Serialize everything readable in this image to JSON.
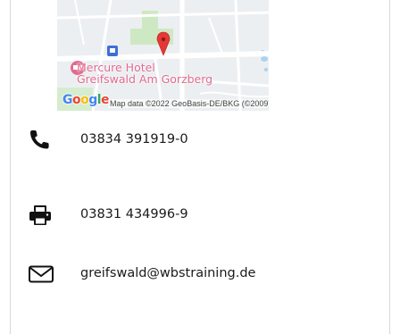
{
  "map": {
    "poi_name_line1": "Mercure Hotel",
    "poi_name_line2": "Greifswald Am Gorzberg",
    "logo_letters": [
      "G",
      "o",
      "o",
      "g",
      "l",
      "e"
    ],
    "attribution": "Map data ©2022 GeoBasis-DE/BKG (©2009)",
    "marker_color": "#e53935",
    "poi_color": "#e26a8f"
  },
  "contact": {
    "phone": {
      "icon": "phone-icon",
      "value": "03834 391919-0"
    },
    "fax": {
      "icon": "printer-icon",
      "value": "03831 434996-9"
    },
    "email": {
      "icon": "envelope-icon",
      "value": "greifswald@wbstraining.de"
    }
  }
}
